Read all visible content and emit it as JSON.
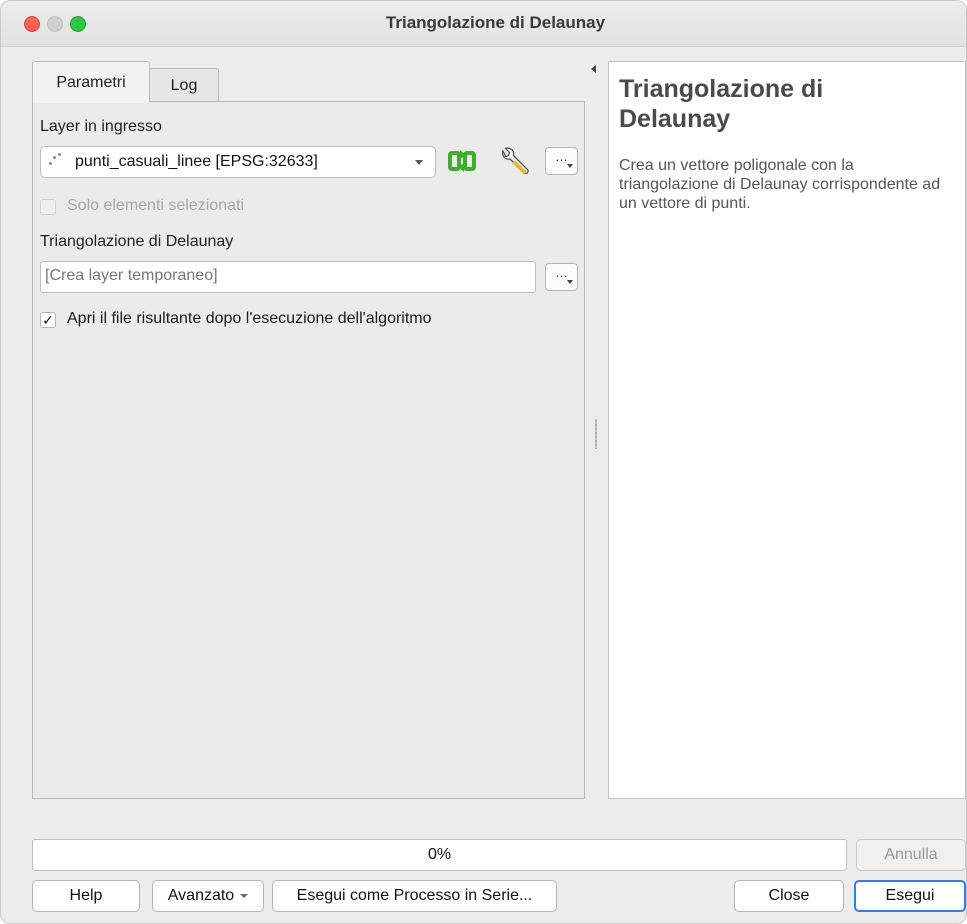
{
  "window": {
    "title": "Triangolazione di Delaunay"
  },
  "tabs": [
    {
      "label": "Parametri",
      "active": true
    },
    {
      "label": "Log",
      "active": false
    }
  ],
  "params": {
    "input_layer_label": "Layer in ingresso",
    "input_layer_value": "punti_casuali_linee [EPSG:32633]",
    "selected_only_label": "Solo elementi selezionati",
    "selected_only_checked": false,
    "output_label": "Triangolazione di Delaunay",
    "output_placeholder": "[Crea layer temporaneo]",
    "open_output_label": "Apri il file risultante dopo l'esecuzione dell'algoritmo",
    "open_output_checked": true,
    "browse_label": "…"
  },
  "help": {
    "title": "Triangolazione di Delaunay",
    "description": "Crea un vettore poligonale con la triangolazione di Delaunay corrispondente ad un vettore di punti."
  },
  "progress": {
    "text": "0%",
    "value": 0
  },
  "buttons": {
    "annulla": "Annulla",
    "help": "Help",
    "avanzato": "Avanzato",
    "batch": "Esegui come Processo in Serie...",
    "close": "Close",
    "esegui": "Esegui"
  },
  "icons": {
    "refresh": "iterate-refresh-icon",
    "settings": "wrench-icon"
  },
  "colors": {
    "accent": "#2f7cf6",
    "refresh_green": "#3fae2a"
  }
}
